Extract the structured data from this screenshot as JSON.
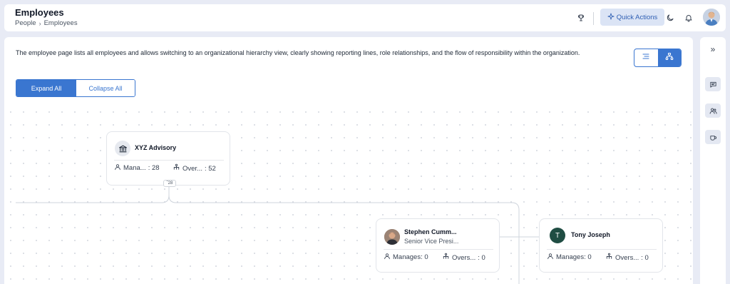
{
  "header": {
    "title": "Employees",
    "breadcrumb": [
      "People",
      "Employees"
    ],
    "quick_actions_label": "Quick Actions"
  },
  "main": {
    "description": "The employee page lists all employees and allows switching to an organizational hierarchy view, clearly showing reporting lines, role relationships, and the flow of responsibility within the organization.",
    "view_toggle": {
      "active": "hierarchy"
    },
    "expand_all_label": "Expand All",
    "collapse_all_label": "Collapse All"
  },
  "org_chart": {
    "root": {
      "name": "XYZ Advisory",
      "manages_label": "Mana...",
      "manages_value": ": 28",
      "oversees_label": "Over...",
      "oversees_value": ": 52",
      "children_count": "28"
    },
    "nodes": [
      {
        "name": "Stephen Cumm...",
        "role": "Senior Vice Presi...",
        "manages_label": "Manages: 0",
        "oversees_label": "Overs...",
        "oversees_value": ": 0"
      },
      {
        "name": "Tony Joseph",
        "initial": "T",
        "manages_label": "Manages: 0",
        "oversees_label": "Overs...",
        "oversees_value": ": 0"
      }
    ]
  },
  "colors": {
    "accent": "#3a76d0",
    "avatar_tony": "#1f4d43"
  },
  "icons": {
    "header": [
      "trophy-icon",
      "sparkle-icon",
      "moon-icon",
      "bell-icon"
    ],
    "rail": [
      "chevrons-right-icon",
      "message-icon",
      "users-icon",
      "coffee-icon"
    ]
  }
}
